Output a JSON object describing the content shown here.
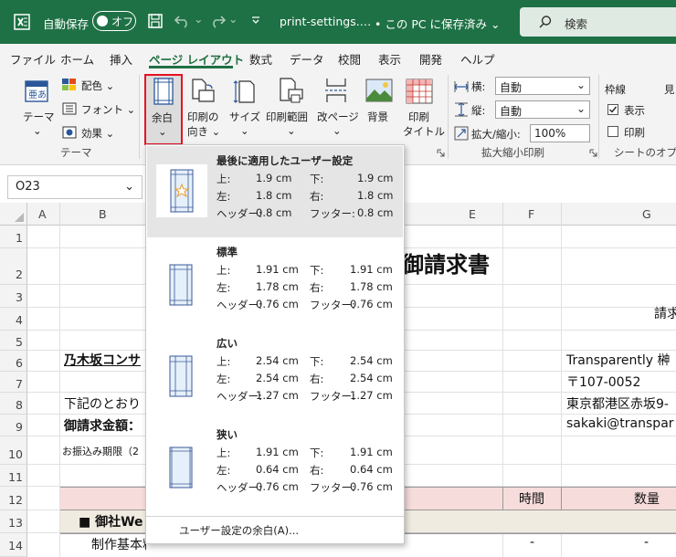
{
  "titlebar": {
    "autosave_label": "自動保存",
    "autosave_state": "オフ",
    "filename": "print-settings.…",
    "save_location": "• この PC に保存済み ⌄",
    "search_placeholder": "検索"
  },
  "menu": [
    "ファイル",
    "ホーム",
    "挿入",
    "ページ レイアウト",
    "数式",
    "データ",
    "校閲",
    "表示",
    "開発",
    "ヘルプ"
  ],
  "ribbon": {
    "theme": {
      "themes": "テーマ",
      "colors": "配色 ⌄",
      "fonts": "フォント ⌄",
      "effects": "効果 ⌄",
      "group": "テーマ",
      "themes_chev": "⌄"
    },
    "page_setup": {
      "margins": "余白",
      "orientation_1": "印刷の",
      "orientation_2": "向き ⌄",
      "size": "サイズ",
      "size_chev": "⌄",
      "print_area": "印刷範囲",
      "print_area_chev": "⌄",
      "breaks": "改ページ",
      "breaks_chev": "⌄",
      "background": "背景",
      "print_titles_1": "印刷",
      "print_titles_2": "タイトル",
      "margins_chev": "⌄"
    },
    "scale": {
      "width_label": "横:",
      "width_value": "自動",
      "height_label": "縦:",
      "height_value": "自動",
      "zoom_label": "拡大/縮小:",
      "zoom_value": "100%",
      "group": "拡大縮小印刷"
    },
    "sheet_options": {
      "gridlines": "枠線",
      "headings": "見",
      "view": "表示",
      "print": "印刷",
      "group": "シートのオプシ"
    }
  },
  "namebox": "O23",
  "columns": [
    "A",
    "B",
    "E",
    "F",
    "G"
  ],
  "rows": [
    "1",
    "2",
    "3",
    "4",
    "5",
    "6",
    "7",
    "8",
    "9",
    "10",
    "11",
    "12",
    "13",
    "14"
  ],
  "sheet": {
    "title": "御請求書",
    "g4": "請求",
    "b6": "乃木坂コンサ",
    "g6": "Transparently 榊",
    "g7": "〒107-0052",
    "b8": "下記のとおり",
    "g8": "東京都港区赤坂9-",
    "b9": "御請求金額：",
    "g9": "sakaki@transpar",
    "b10": "お振込み期限（2",
    "f12": "時間",
    "g12": "数量",
    "b13": "■ 御社We",
    "b14": "制作基本料金",
    "f14": "-",
    "g14": "-"
  },
  "margins_menu": {
    "options": [
      {
        "title": "最後に適用したユーザー設定",
        "top": "1.9 cm",
        "bottom": "1.9 cm",
        "left": "1.8 cm",
        "right": "1.8 cm",
        "header": "0.8 cm",
        "footer": "0.8 cm"
      },
      {
        "title": "標準",
        "top": "1.91 cm",
        "bottom": "1.91 cm",
        "left": "1.78 cm",
        "right": "1.78 cm",
        "header": "0.76 cm",
        "footer": "0.76 cm"
      },
      {
        "title": "広い",
        "top": "2.54 cm",
        "bottom": "2.54 cm",
        "left": "2.54 cm",
        "right": "2.54 cm",
        "header": "1.27 cm",
        "footer": "1.27 cm"
      },
      {
        "title": "狭い",
        "top": "1.91 cm",
        "bottom": "1.91 cm",
        "left": "0.64 cm",
        "right": "0.64 cm",
        "header": "0.76 cm",
        "footer": "0.76 cm"
      }
    ],
    "labels": {
      "top": "上:",
      "bottom": "下:",
      "left": "左:",
      "right": "右:",
      "header": "ヘッダー:",
      "footer": "フッター:"
    },
    "custom": "ユーザー設定の余白(A)..."
  },
  "colors": {
    "excel_green": "#1e7145",
    "highlight_red": "#e81123",
    "menu_selected": "#e5e5e5",
    "header_fill": "#f7dcdc",
    "section_fill": "#f0ebe0"
  }
}
